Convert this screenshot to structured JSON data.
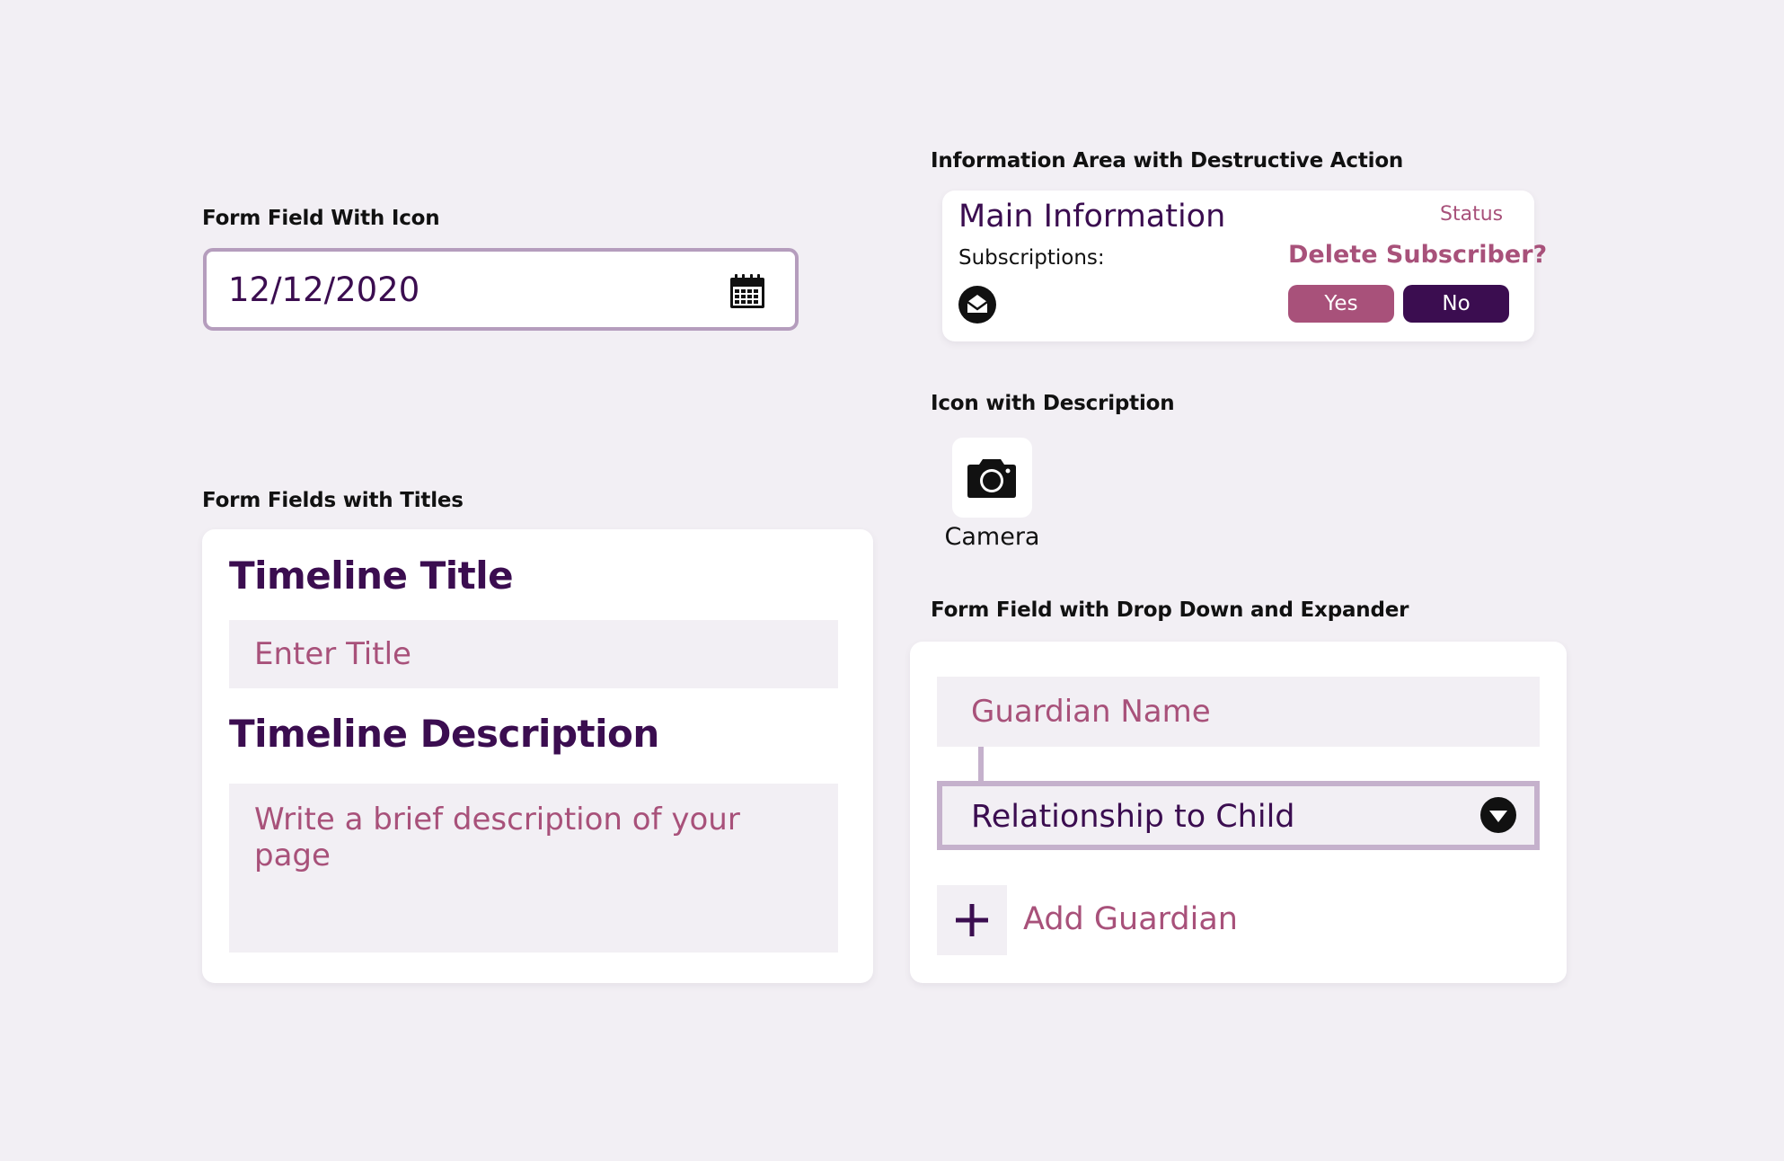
{
  "labels": {
    "form_field_icon": "Form Field With Icon",
    "form_fields_titles": "Form Fields with Titles",
    "info_area": "Information Area with Destructive Action",
    "icon_description": "Icon with Description",
    "dropdown_expander": "Form Field with Drop Down and Expander"
  },
  "date_field": {
    "value": "12/12/2020",
    "icon": "calendar-icon"
  },
  "info_card": {
    "title": "Main Information",
    "status": "Status",
    "subscriptions_label": "Subscriptions:",
    "subscription_icon": "envelope-open-icon",
    "delete_prompt": "Delete Subscriber?",
    "yes_label": "Yes",
    "no_label": "No"
  },
  "camera": {
    "icon": "camera-icon",
    "caption": "Camera"
  },
  "timeline": {
    "title_heading": "Timeline Title",
    "title_placeholder": "Enter Title",
    "description_heading": "Timeline Description",
    "description_placeholder": "Write a brief description of your page"
  },
  "guardian": {
    "name_placeholder": "Guardian Name",
    "relationship_value": "Relationship to Child",
    "dropdown_icon": "chevron-down-circle-icon",
    "add_icon": "plus-icon",
    "add_label": "Add Guardian"
  },
  "colors": {
    "background": "#f2eff4",
    "primary": "#3b0d50",
    "accent": "#a8517a",
    "field_border": "#b59dbd",
    "select_border": "#c5b1cc"
  }
}
